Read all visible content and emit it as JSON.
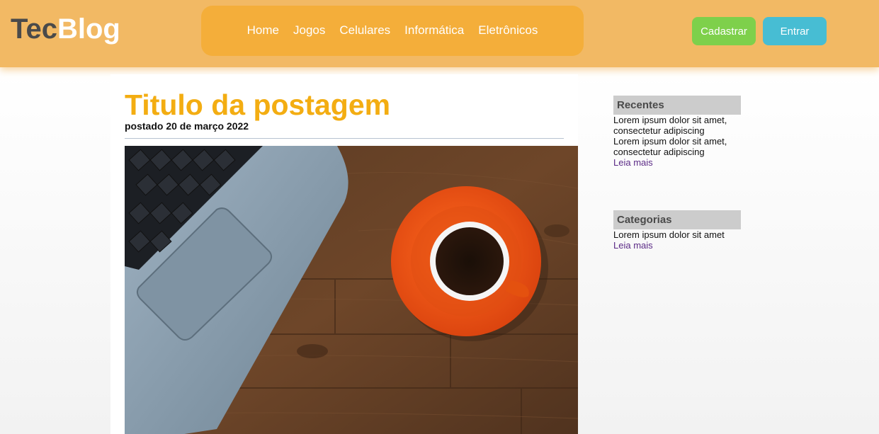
{
  "header": {
    "logo_part1": "Tec",
    "logo_part2": "Blog",
    "nav": [
      "Home",
      "Jogos",
      "Celulares",
      "Informática",
      "Eletrônicos"
    ],
    "signup_label": "Cadastrar",
    "login_label": "Entrar"
  },
  "post": {
    "title": "Titulo da postagem",
    "date": "postado 20 de março 2022",
    "image_icon": "laptop-coffee-photo"
  },
  "sidebar": {
    "recentes": {
      "title": "Recentes",
      "items": [
        "Lorem ipsum dolor sit amet, consectetur adipiscing",
        "Lorem ipsum dolor sit amet, consectetur adipiscing"
      ],
      "link": "Leia mais"
    },
    "categorias": {
      "title": "Categorias",
      "items": [
        "Lorem ipsum dolor sit amet"
      ],
      "link": "Leia mais"
    }
  },
  "colors": {
    "header_bg": "#f2b964",
    "nav_bg": "#f4ae3a",
    "title": "#f3ad12",
    "signup": "#7ed04b",
    "login": "#47bdd3",
    "link": "#5b2a86"
  }
}
